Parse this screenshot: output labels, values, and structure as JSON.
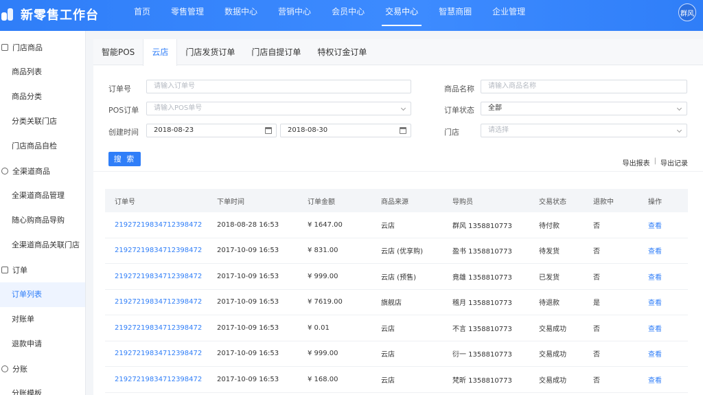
{
  "header": {
    "app_title": "新零售工作台",
    "nav": [
      "首页",
      "零售管理",
      "数据中心",
      "营销中心",
      "会员中心",
      "交易中心",
      "智慧商圈",
      "企业管理"
    ],
    "active_nav": "交易中心",
    "user": "群风"
  },
  "sidebar": {
    "groups": [
      {
        "label": "门店商品",
        "items": [
          "商品列表",
          "商品分类",
          "分类关联门店",
          "门店商品自检"
        ]
      },
      {
        "label": "全渠道商品",
        "items": [
          "全渠道商品管理",
          "随心购商品导购",
          "全渠道商品关联门店"
        ]
      },
      {
        "label": "订单",
        "items": [
          "订单列表",
          "对账单",
          "退款申请"
        ]
      },
      {
        "label": "分账",
        "items": [
          "分账模板"
        ]
      }
    ],
    "active_item": "订单列表"
  },
  "tabs": [
    "智能POS",
    "云店",
    "门店发货订单",
    "门店自提订单",
    "特权订金订单"
  ],
  "active_tab": "云店",
  "filters": {
    "order_no": {
      "label": "订单号",
      "placeholder": "请输入订单号"
    },
    "pos_order": {
      "label": "POS订单",
      "placeholder": "请输入POS单号"
    },
    "created": {
      "label": "创建时间",
      "start": "2018-08-23",
      "end": "2018-08-30"
    },
    "product_name": {
      "label": "商品名称",
      "placeholder": "请输入商品名称"
    },
    "order_status": {
      "label": "订单状态",
      "value": "全部"
    },
    "store": {
      "label": "门店",
      "placeholder": "请选择"
    },
    "search_label": "搜 索",
    "export_report": "导出报表",
    "export_record": "导出记录",
    "separator": "|"
  },
  "table": {
    "headers": [
      "订单号",
      "下单时间",
      "订单金额",
      "商品来源",
      "导购员",
      "交易状态",
      "退款中",
      "操作"
    ],
    "rows": [
      {
        "order_no": "21927219834712398472",
        "time": "2018-08-28 16:53",
        "amount": "¥ 1647.00",
        "source": "云店",
        "guide": "群风 1358810773",
        "status": "待付款",
        "refunding": "否",
        "action": "查看"
      },
      {
        "order_no": "21927219834712398472",
        "time": "2017-10-09 16:53",
        "amount": "¥ 831.00",
        "source": "云店 (优享购)",
        "guide": "盈书 1358810773",
        "status": "待发货",
        "refunding": "否",
        "action": "查看"
      },
      {
        "order_no": "21927219834712398472",
        "time": "2017-10-09 16:53",
        "amount": "¥ 999.00",
        "source": "云店 (预售)",
        "guide": "竟雄 1358810773",
        "status": "已发货",
        "refunding": "否",
        "action": "查看"
      },
      {
        "order_no": "21927219834712398472",
        "time": "2017-10-09 16:53",
        "amount": "¥ 7619.00",
        "source": "旗舰店",
        "guide": "稽月 1358810773",
        "status": "待退款",
        "refunding": "是",
        "action": "查看"
      },
      {
        "order_no": "21927219834712398472",
        "time": "2017-10-09 16:53",
        "amount": "¥ 0.01",
        "source": "云店",
        "guide": "不言 1358810773",
        "status": "交易成功",
        "refunding": "否",
        "action": "查看"
      },
      {
        "order_no": "21927219834712398472",
        "time": "2017-10-09 16:53",
        "amount": "¥ 999.00",
        "source": "云店",
        "guide": "衍一 1358810773",
        "status": "交易成功",
        "refunding": "否",
        "action": "查看"
      },
      {
        "order_no": "21927219834712398472",
        "time": "2017-10-09 16:53",
        "amount": "¥ 168.00",
        "source": "云店",
        "guide": "梵昕 1358810773",
        "status": "交易成功",
        "refunding": "否",
        "action": "查看"
      }
    ]
  },
  "colors": {
    "primary": "#2f7ef8",
    "header_bg": "#3d8bff",
    "page_bg": "#f3f5f8"
  }
}
